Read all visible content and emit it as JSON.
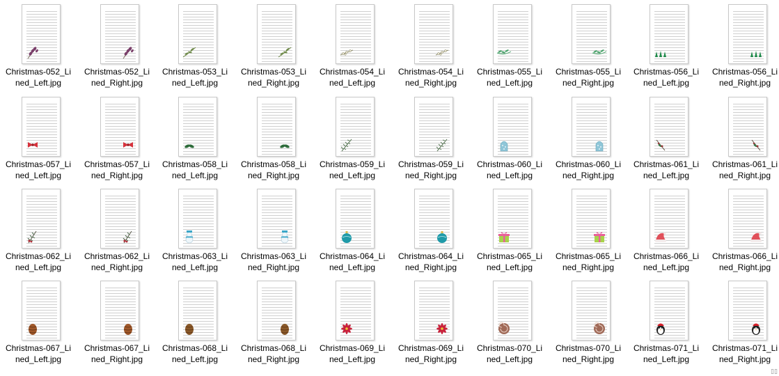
{
  "files": [
    {
      "name": "Christmas-052_Lined_Left.jpg",
      "line1": "Christmas-052_Li",
      "line2": "ned_Left.jpg",
      "icon": "lavender-sprig-icon",
      "side": "left",
      "color": "#7a3f6a"
    },
    {
      "name": "Christmas-052_Lined_Right.jpg",
      "line1": "Christmas-052_Li",
      "line2": "ned_Right.jpg",
      "icon": "lavender-sprig-icon",
      "side": "right",
      "color": "#7a3f6a"
    },
    {
      "name": "Christmas-053_Lined_Left.jpg",
      "line1": "Christmas-053_Li",
      "line2": "ned_Left.jpg",
      "icon": "olive-branch-icon",
      "side": "left",
      "color": "#6f8a4a"
    },
    {
      "name": "Christmas-053_Lined_Right.jpg",
      "line1": "Christmas-053_Li",
      "line2": "ned_Right.jpg",
      "icon": "olive-branch-icon",
      "side": "right",
      "color": "#6f8a4a"
    },
    {
      "name": "Christmas-054_Lined_Left.jpg",
      "line1": "Christmas-054_Li",
      "line2": "ned_Left.jpg",
      "icon": "berry-branch-icon",
      "side": "left",
      "color": "#8b8b6a"
    },
    {
      "name": "Christmas-054_Lined_Right.jpg",
      "line1": "Christmas-054_Li",
      "line2": "ned_Right.jpg",
      "icon": "berry-branch-icon",
      "side": "right",
      "color": "#8b8b6a"
    },
    {
      "name": "Christmas-055_Lined_Left.jpg",
      "line1": "Christmas-055_Li",
      "line2": "ned_Left.jpg",
      "icon": "leaf-garland-icon",
      "side": "left",
      "color": "#4aa36b"
    },
    {
      "name": "Christmas-055_Lined_Right.jpg",
      "line1": "Christmas-055_Li",
      "line2": "ned_Right.jpg",
      "icon": "leaf-garland-icon",
      "side": "right",
      "color": "#4aa36b"
    },
    {
      "name": "Christmas-056_Lined_Left.jpg",
      "line1": "Christmas-056_Li",
      "line2": "ned_Left.jpg",
      "icon": "holly-leaves-icon",
      "side": "left",
      "color": "#1f8a4a"
    },
    {
      "name": "Christmas-056_Lined_Right.jpg",
      "line1": "Christmas-056_Li",
      "line2": "ned_Right.jpg",
      "icon": "holly-leaves-icon",
      "side": "right",
      "color": "#1f8a4a"
    },
    {
      "name": "Christmas-057_Lined_Left.jpg",
      "line1": "Christmas-057_Li",
      "line2": "ned_Left.jpg",
      "icon": "red-bow-icon",
      "side": "left",
      "color": "#d6323c"
    },
    {
      "name": "Christmas-057_Lined_Right.jpg",
      "line1": "Christmas-057_Li",
      "line2": "ned_Right.jpg",
      "icon": "red-bow-icon",
      "side": "right",
      "color": "#d6323c"
    },
    {
      "name": "Christmas-058_Lined_Left.jpg",
      "line1": "Christmas-058_Li",
      "line2": "ned_Left.jpg",
      "icon": "green-leaves-icon",
      "side": "left",
      "color": "#2d6b3a"
    },
    {
      "name": "Christmas-058_Lined_Right.jpg",
      "line1": "Christmas-058_Li",
      "line2": "ned_Right.jpg",
      "icon": "green-leaves-icon",
      "side": "right",
      "color": "#2d6b3a"
    },
    {
      "name": "Christmas-059_Lined_Left.jpg",
      "line1": "Christmas-059_Li",
      "line2": "ned_Left.jpg",
      "icon": "pine-branch-icon",
      "side": "left",
      "color": "#5d7a5a"
    },
    {
      "name": "Christmas-059_Lined_Right.jpg",
      "line1": "Christmas-059_Li",
      "line2": "ned_Right.jpg",
      "icon": "pine-branch-icon",
      "side": "right",
      "color": "#5d7a5a"
    },
    {
      "name": "Christmas-060_Lined_Left.jpg",
      "line1": "Christmas-060_Li",
      "line2": "ned_Left.jpg",
      "icon": "snow-globe-icon",
      "side": "left",
      "color": "#8fc6d8"
    },
    {
      "name": "Christmas-060_Lined_Right.jpg",
      "line1": "Christmas-060_Li",
      "line2": "ned_Right.jpg",
      "icon": "snow-globe-icon",
      "side": "right",
      "color": "#8fc6d8"
    },
    {
      "name": "Christmas-061_Lined_Left.jpg",
      "line1": "Christmas-061_Li",
      "line2": "ned_Left.jpg",
      "icon": "holly-berries-icon",
      "side": "left",
      "color": "#9a3a3a"
    },
    {
      "name": "Christmas-061_Lined_Right.jpg",
      "line1": "Christmas-061_Li",
      "line2": "ned_Right.jpg",
      "icon": "holly-berries-icon",
      "side": "right",
      "color": "#9a3a3a"
    },
    {
      "name": "Christmas-062_Lined_Left.jpg",
      "line1": "Christmas-062_Li",
      "line2": "ned_Left.jpg",
      "icon": "pine-berries-icon",
      "side": "left",
      "color": "#b0303a"
    },
    {
      "name": "Christmas-062_Lined_Right.jpg",
      "line1": "Christmas-062_Li",
      "line2": "ned_Right.jpg",
      "icon": "pine-berries-icon",
      "side": "right",
      "color": "#b0303a"
    },
    {
      "name": "Christmas-063_Lined_Left.jpg",
      "line1": "Christmas-063_Li",
      "line2": "ned_Left.jpg",
      "icon": "snowman-icon",
      "side": "left",
      "color": "#3aa6c8"
    },
    {
      "name": "Christmas-063_Lined_Right.jpg",
      "line1": "Christmas-063_Li",
      "line2": "ned_Right.jpg",
      "icon": "snowman-icon",
      "side": "right",
      "color": "#3aa6c8"
    },
    {
      "name": "Christmas-064_Lined_Left.jpg",
      "line1": "Christmas-064_Li",
      "line2": "ned_Left.jpg",
      "icon": "ornament-ball-icon",
      "side": "left",
      "color": "#1f9aa8"
    },
    {
      "name": "Christmas-064_Lined_Right.jpg",
      "line1": "Christmas-064_Li",
      "line2": "ned_Right.jpg",
      "icon": "ornament-ball-icon",
      "side": "right",
      "color": "#1f9aa8"
    },
    {
      "name": "Christmas-065_Lined_Left.jpg",
      "line1": "Christmas-065_Li",
      "line2": "ned_Left.jpg",
      "icon": "gift-box-icon",
      "side": "left",
      "color": "#a8d24a"
    },
    {
      "name": "Christmas-065_Lined_Right.jpg",
      "line1": "Christmas-065_Li",
      "line2": "ned_Right.jpg",
      "icon": "gift-box-icon",
      "side": "right",
      "color": "#a8d24a"
    },
    {
      "name": "Christmas-066_Lined_Left.jpg",
      "line1": "Christmas-066_Li",
      "line2": "ned_Left.jpg",
      "icon": "santa-hat-icon",
      "side": "left",
      "color": "#e0505a"
    },
    {
      "name": "Christmas-066_Lined_Right.jpg",
      "line1": "Christmas-066_Li",
      "line2": "ned_Right.jpg",
      "icon": "santa-hat-icon",
      "side": "right",
      "color": "#e0505a"
    },
    {
      "name": "Christmas-067_Lined_Left.jpg",
      "line1": "Christmas-067_Li",
      "line2": "ned_Left.jpg",
      "icon": "pine-cone-icon",
      "side": "left",
      "color": "#a0582a"
    },
    {
      "name": "Christmas-067_Lined_Right.jpg",
      "line1": "Christmas-067_Li",
      "line2": "ned_Right.jpg",
      "icon": "pine-cone-icon",
      "side": "right",
      "color": "#a0582a"
    },
    {
      "name": "Christmas-068_Lined_Left.jpg",
      "line1": "Christmas-068_Li",
      "line2": "ned_Left.jpg",
      "icon": "pine-cone-icon",
      "side": "left",
      "color": "#8a5a2a"
    },
    {
      "name": "Christmas-068_Lined_Right.jpg",
      "line1": "Christmas-068_Li",
      "line2": "ned_Right.jpg",
      "icon": "pine-cone-icon",
      "side": "right",
      "color": "#8a5a2a"
    },
    {
      "name": "Christmas-069_Lined_Left.jpg",
      "line1": "Christmas-069_Li",
      "line2": "ned_Left.jpg",
      "icon": "poinsettia-icon",
      "side": "left",
      "color": "#c8203a"
    },
    {
      "name": "Christmas-069_Lined_Right.jpg",
      "line1": "Christmas-069_Li",
      "line2": "ned_Right.jpg",
      "icon": "poinsettia-icon",
      "side": "right",
      "color": "#c8203a"
    },
    {
      "name": "Christmas-070_Lined_Left.jpg",
      "line1": "Christmas-070_Li",
      "line2": "ned_Left.jpg",
      "icon": "cinnamon-roll-icon",
      "side": "left",
      "color": "#a06a58"
    },
    {
      "name": "Christmas-070_Lined_Right.jpg",
      "line1": "Christmas-070_Li",
      "line2": "ned_Right.jpg",
      "icon": "cinnamon-roll-icon",
      "side": "right",
      "color": "#a06a58"
    },
    {
      "name": "Christmas-071_Lined_Left.jpg",
      "line1": "Christmas-071_Li",
      "line2": "ned_Left.jpg",
      "icon": "penguin-icon",
      "side": "left",
      "color": "#222222"
    },
    {
      "name": "Christmas-071_Lined_Right.jpg",
      "line1": "Christmas-071_Li",
      "line2": "ned_Right.jpg",
      "icon": "penguin-icon",
      "side": "right",
      "color": "#222222"
    }
  ],
  "status_icon": "view-toggle-icon"
}
